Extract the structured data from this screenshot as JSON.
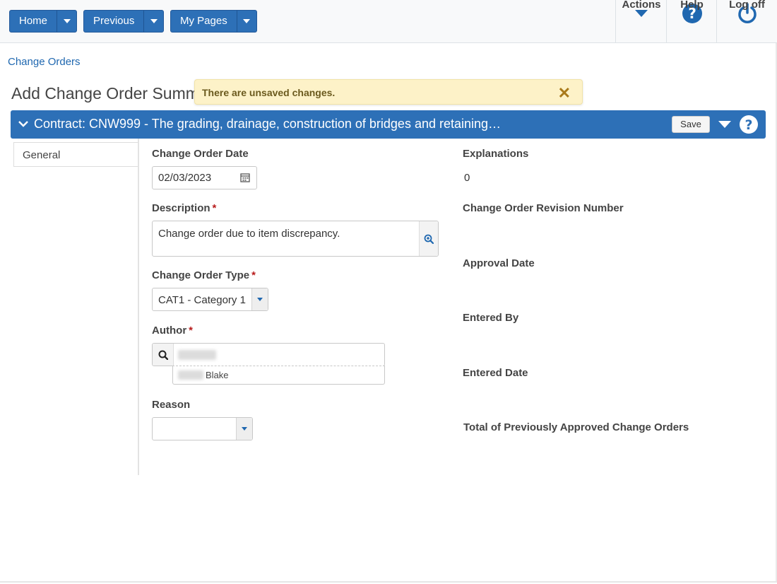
{
  "nav": {
    "home_label": "Home",
    "previous_label": "Previous",
    "mypages_label": "My Pages"
  },
  "top_actions": {
    "actions_label": "Actions",
    "help_label": "Help",
    "logoff_label": "Log off"
  },
  "breadcrumb": "Change Orders",
  "page_title": "Add Change Order Summary",
  "toast": {
    "message": "There are unsaved changes.",
    "close": "✕"
  },
  "contract_bar": {
    "title": "Contract: CNW999 - The grading, drainage, construction of bridges and retaining…",
    "save_label": "Save"
  },
  "side_tabs": [
    {
      "label": "General"
    }
  ],
  "form": {
    "change_order_date": {
      "label": "Change Order Date",
      "value": "02/03/2023"
    },
    "description": {
      "label": "Description",
      "value": "Change order due to item discrepancy."
    },
    "change_order_type": {
      "label": "Change Order Type",
      "value": "CAT1 - Category 1"
    },
    "author": {
      "label": "Author",
      "suggestion": "Blake"
    },
    "reason": {
      "label": "Reason",
      "value": ""
    }
  },
  "details": {
    "explanations": {
      "label": "Explanations",
      "value": "0"
    },
    "revision_number": {
      "label": "Change Order Revision Number"
    },
    "approval_date": {
      "label": "Approval Date"
    },
    "entered_by": {
      "label": "Entered By"
    },
    "entered_date": {
      "label": "Entered Date"
    },
    "total_previous": {
      "label": "Total of Previously Approved Change Orders"
    }
  },
  "colors": {
    "primary": "#2d70b7",
    "link": "#2068b0",
    "toast_bg": "#fdf2c8",
    "required": "#b81c1c"
  }
}
